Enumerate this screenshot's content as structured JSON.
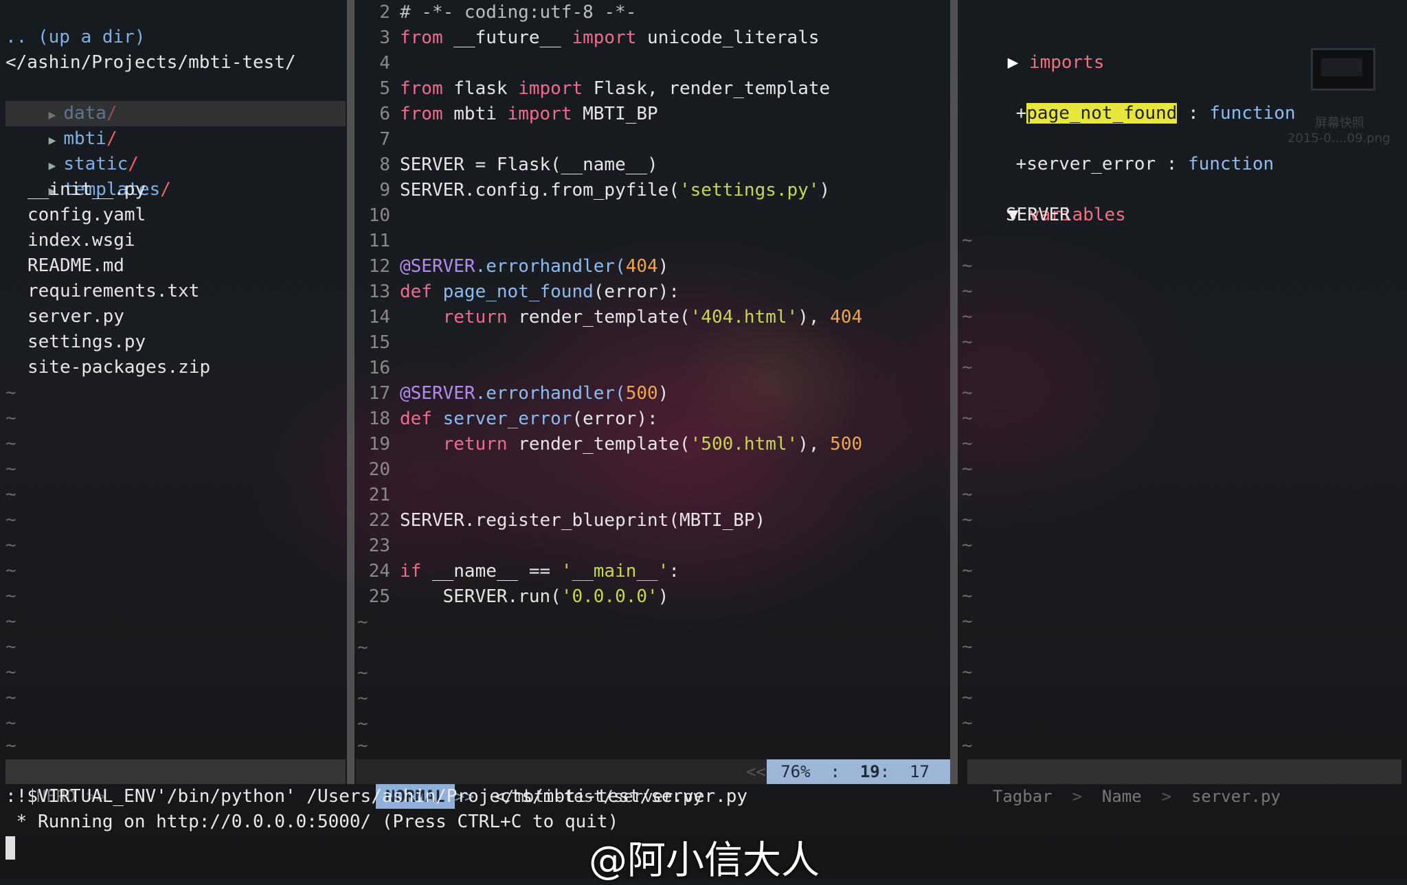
{
  "nerdtree": {
    "up_dir": ".. (up a dir)",
    "root": "</ashin/Projects/mbti-test/",
    "dirs": [
      {
        "name": "data",
        "slash": "/"
      },
      {
        "name": "mbti",
        "slash": "/"
      },
      {
        "name": "static",
        "slash": "/"
      },
      {
        "name": "templates",
        "slash": "/"
      }
    ],
    "files": [
      "__init__.py",
      "config.yaml",
      "index.wsgi",
      "README.md",
      "requirements.txt",
      "server.py",
      "settings.py",
      "site-packages.zip"
    ],
    "tilde": "~"
  },
  "editor": {
    "line_numbers": [
      "2",
      "3",
      "4",
      "5",
      "6",
      "7",
      "8",
      "9",
      "10",
      "11",
      "12",
      "13",
      "14",
      "15",
      "16",
      "17",
      "18",
      "19",
      "20",
      "21",
      "22",
      "23",
      "24",
      "25"
    ],
    "tilde": "~",
    "code": {
      "l2": "# -*- coding:utf-8 -*-",
      "l3a": "from",
      "l3b": " __future__ ",
      "l3c": "import",
      "l3d": " unicode_literals",
      "l5a": "from",
      "l5b": " flask ",
      "l5c": "import",
      "l5d": " Flask, render_template",
      "l6a": "from",
      "l6b": " mbti ",
      "l6c": "import",
      "l6d": " MBTI_BP",
      "l8": "SERVER = Flask(__name__)",
      "l9a": "SERVER.config.from_pyfile(",
      "l9b": "'settings.py'",
      "l9c": ")",
      "l12a": "@SERVER",
      "l12b": ".errorhandler(",
      "l12c": "404",
      "l12d": ")",
      "l13a": "def",
      "l13b": " page_not_found",
      "l13c": "(error):",
      "l14a": "    return",
      "l14b": " render_template(",
      "l14c": "'404.html'",
      "l14d": "), ",
      "l14e": "404",
      "l17a": "@SERVER",
      "l17b": ".errorhandler(",
      "l17c": "500",
      "l17d": ")",
      "l18a": "def",
      "l18b": " server_error",
      "l18c": "(error):",
      "l19a": "    return",
      "l19b": " render_template(",
      "l19c": "'500.html'",
      "l19d": "), ",
      "l19e": "500",
      "l22": "SERVER.register_blueprint(MBTI_BP)",
      "l24a": "if",
      "l24b": " __name__ == ",
      "l24c": "'__main__'",
      "l24d": ":",
      "l25a": "    SERVER.run(",
      "l25b": "'0.0.0.0'",
      "l25c": ")"
    }
  },
  "tagbar": {
    "imports_label": "imports",
    "fn1_prefix": "+",
    "fn1_name": "page_not_found",
    "fn1_sep": " : ",
    "fn1_type": "function",
    "fn2_prefix": "+",
    "fn2_name": "server_error",
    "fn2_sep": " : ",
    "fn2_type": "function",
    "variables_label": "variables",
    "var1": "SERVER",
    "tilde": "~"
  },
  "status": {
    "nerd": "NERD",
    "nerd_sep": ">>",
    "mode": "NORMAL",
    "mode_sep": ">>",
    "file": "</mbti-test/server.py",
    "left_sep": "<<",
    "right_arrow": "<",
    "percent": "76%",
    "colon": ":",
    "line": "19",
    "col": "17",
    "tagbar": "Tagbar",
    "tb_sep1": ">",
    "tb_name": "Name",
    "tb_sep2": ">",
    "tb_file": "server.py"
  },
  "command": {
    "line1": ":!$VIRTUAL_ENV'/bin/python' /Users/ashin/Projects/mbti-test/server.py",
    "line2": " * Running on http://0.0.0.0:5000/ (Press CTRL+C to quit)"
  },
  "desktop": {
    "icon_label1": "屏幕快照",
    "icon_label2": "2015-0....09.png"
  },
  "watermark": "@阿小信大人"
}
